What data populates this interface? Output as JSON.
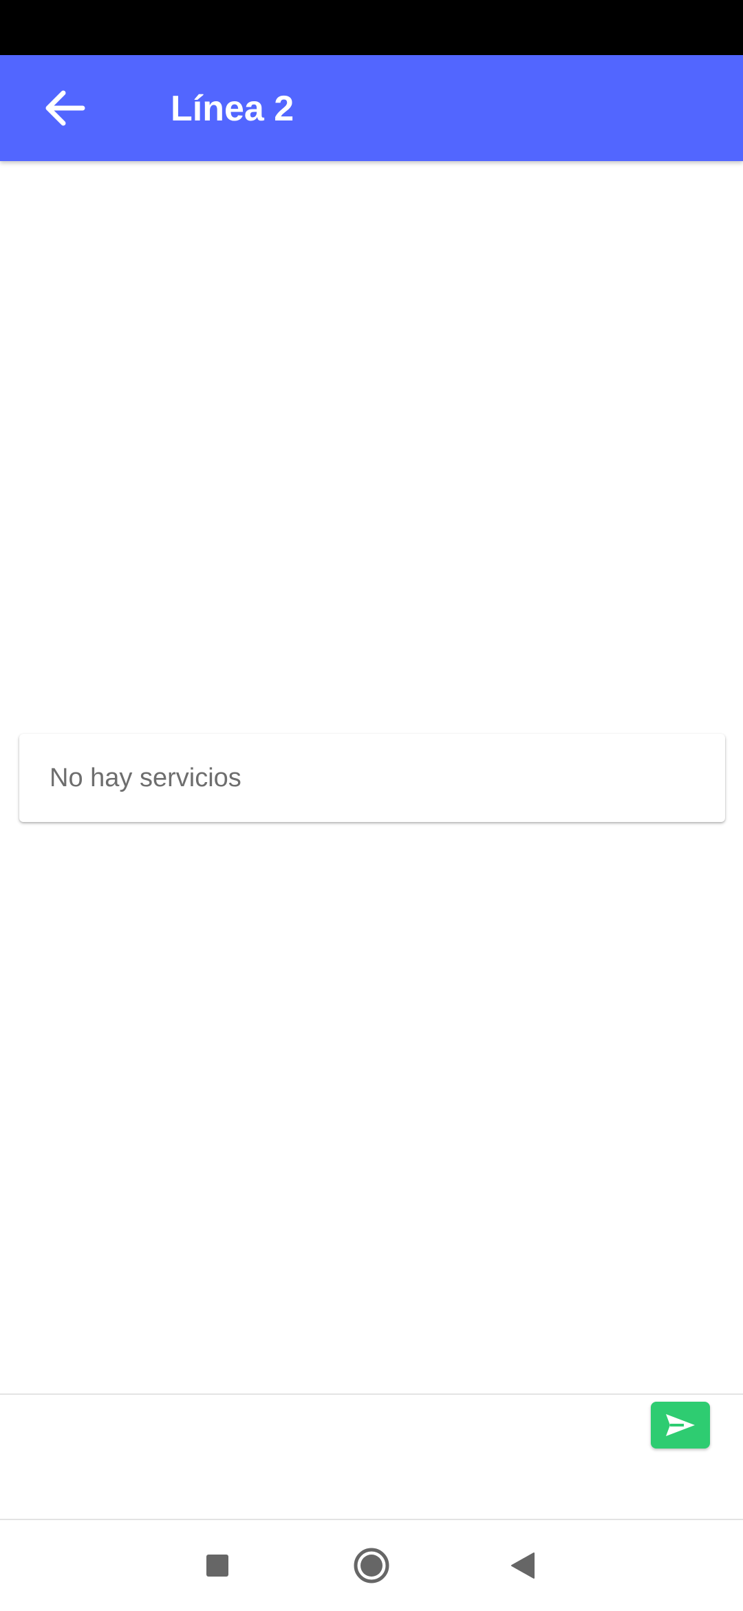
{
  "app_bar": {
    "title": "Línea 2",
    "back_icon": "arrow-back-icon",
    "background_color": "#5266ff"
  },
  "main": {
    "empty_message": "No hay servicios"
  },
  "composer": {
    "send_icon": "send-icon",
    "send_color": "#2ecc71"
  },
  "nav_bar": {
    "recents_icon": "square-icon",
    "home_icon": "circle-icon",
    "back_icon": "triangle-back-icon"
  }
}
